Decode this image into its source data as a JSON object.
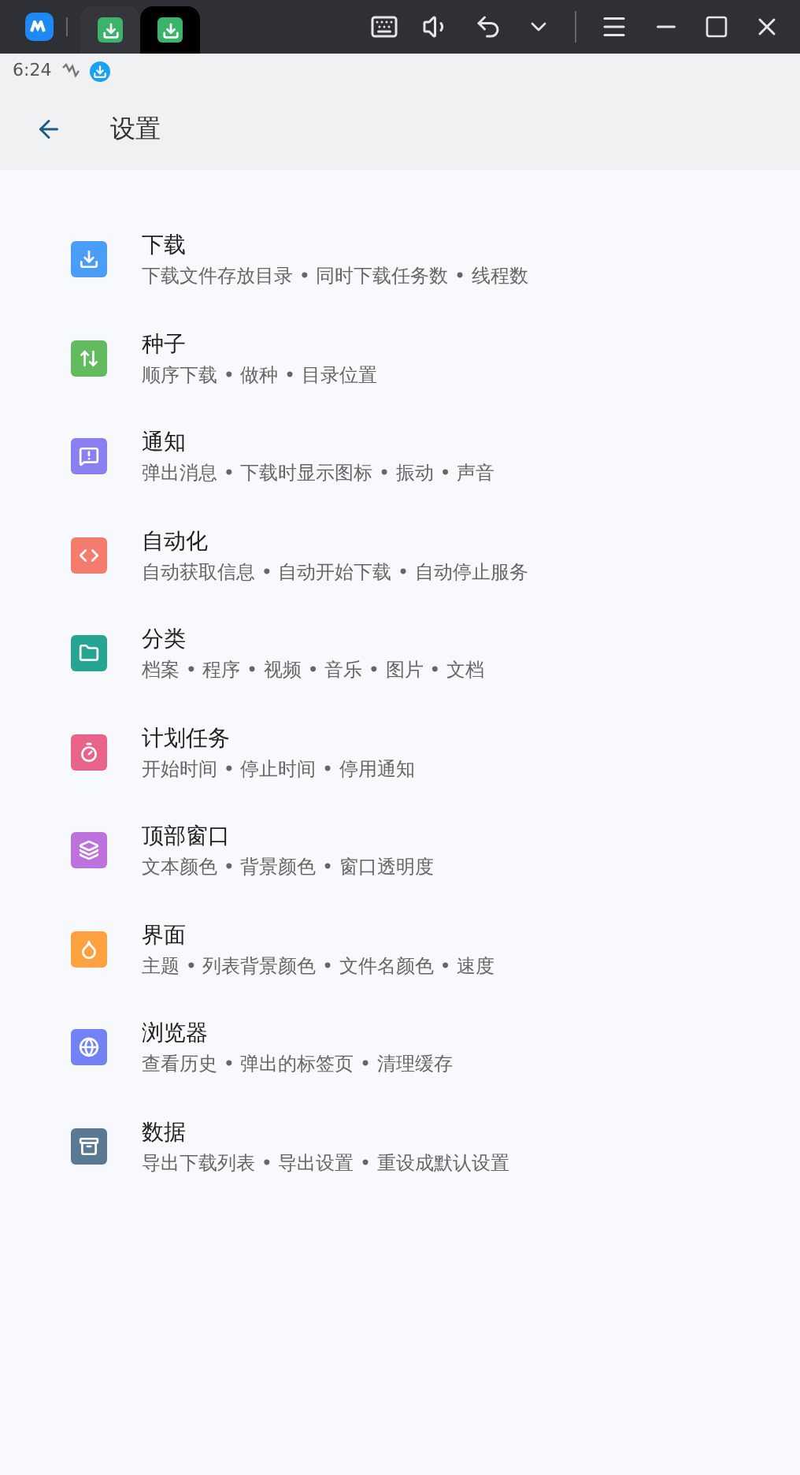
{
  "window_tabs": [
    {
      "selected": false
    },
    {
      "selected": true
    }
  ],
  "status_bar": {
    "time": "6:24"
  },
  "app_bar": {
    "title": "设置"
  },
  "settings": [
    {
      "title": "下载",
      "summary": "下载文件存放目录 • 同时下载任务数 • 线程数",
      "color": "#4a9df8"
    },
    {
      "title": "种子",
      "summary": "顺序下载 • 做种 • 目录位置",
      "color": "#62bb5e"
    },
    {
      "title": "通知",
      "summary": "弹出消息 • 下载时显示图标 • 振动 • 声音",
      "color": "#8a7ff0"
    },
    {
      "title": "自动化",
      "summary": "自动获取信息 • 自动开始下载 • 自动停止服务",
      "color": "#f47b6e"
    },
    {
      "title": "分类",
      "summary": "档案 • 程序 • 视频 • 音乐 • 图片 • 文档",
      "color": "#27a593"
    },
    {
      "title": "计划任务",
      "summary": "开始时间 • 停止时间 • 停用通知",
      "color": "#e9648b"
    },
    {
      "title": "顶部窗口",
      "summary": "文本颜色 • 背景颜色 • 窗口透明度",
      "color": "#bc72dc"
    },
    {
      "title": "界面",
      "summary": "主题 • 列表背景颜色 • 文件名颜色 • 速度",
      "color": "#fea140"
    },
    {
      "title": "浏览器",
      "summary": "查看历史 • 弹出的标签页 • 清理缓存",
      "color": "#7183f4"
    },
    {
      "title": "数据",
      "summary": "导出下载列表 • 导出设置 • 重设成默认设置",
      "color": "#5a7a94"
    }
  ]
}
